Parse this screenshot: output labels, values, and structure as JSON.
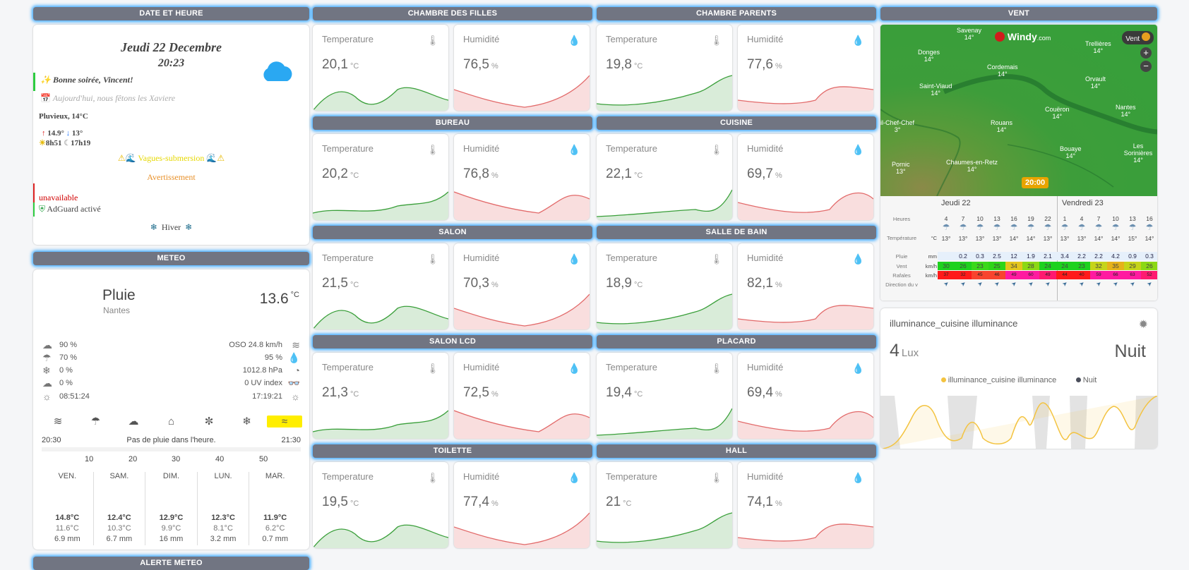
{
  "date": {
    "header": "DATE ET HEURE",
    "day": "Jeudi 22 Decembre",
    "time": "20:23",
    "greeting": "Bonne soirée, Vincent!",
    "saint": "Aujourd'hui, nous fêtons les Xaviere",
    "weather": "Pluvieux, 14°C",
    "tmax": "14.9°",
    "tmin": "13°",
    "sunrise": "8h51",
    "sunset": "17h19",
    "alert_text": "Vagues-submersion",
    "alert_level": "Avertissement",
    "unavailable": "unavailable",
    "adguard": "AdGuard activé",
    "season": "Hiver"
  },
  "meteo": {
    "header": "METEO",
    "condition": "Pluie",
    "city": "Nantes",
    "temp": "13.6",
    "temp_unit": "°C",
    "left": [
      "90 %",
      "70 %",
      "0 %",
      "0 %",
      "08:51:24"
    ],
    "right": [
      "OSO 24.8 km/h",
      "95 %",
      "1012.8 hPa",
      "0 UV index",
      "17:19:21"
    ],
    "rain_start": "20:30",
    "rain_text": "Pas de pluie dans l'heure.",
    "rain_end": "21:30",
    "rain_ticks": [
      "10",
      "20",
      "30",
      "40",
      "50"
    ],
    "forecast": [
      {
        "day": "VEN.",
        "hi": "14.8°C",
        "lo": "11.6°C",
        "rain": "6.9 mm"
      },
      {
        "day": "SAM.",
        "hi": "12.4°C",
        "lo": "10.3°C",
        "rain": "6.7 mm"
      },
      {
        "day": "DIM.",
        "hi": "12.9°C",
        "lo": "9.9°C",
        "rain": "16 mm"
      },
      {
        "day": "LUN.",
        "hi": "12.3°C",
        "lo": "8.1°C",
        "rain": "3.2 mm"
      },
      {
        "day": "MAR.",
        "hi": "11.9°C",
        "lo": "6.2°C",
        "rain": "0.7 mm"
      }
    ]
  },
  "alert_header": "ALERTE METEO",
  "rooms": [
    {
      "name": "CHAMBRE DES FILLES",
      "t": "20,1",
      "h": "76,5"
    },
    {
      "name": "CHAMBRE PARENTS",
      "t": "19,8",
      "h": "77,6"
    },
    {
      "name": "BUREAU",
      "t": "20,2",
      "h": "76,8"
    },
    {
      "name": "CUISINE",
      "t": "22,1",
      "h": "69,7"
    },
    {
      "name": "SALON",
      "t": "21,5",
      "h": "70,3"
    },
    {
      "name": "SALLE DE BAIN",
      "t": "18,9",
      "h": "82,1"
    },
    {
      "name": "SALON LCD",
      "t": "21,3",
      "h": "72,5"
    },
    {
      "name": "PLACARD",
      "t": "19,4",
      "h": "69,4"
    },
    {
      "name": "TOILETTE",
      "t": "19,5",
      "h": "77,4"
    },
    {
      "name": "HALL",
      "t": "21",
      "h": "74,1"
    }
  ],
  "labels": {
    "temp": "Temperature",
    "hum": "Humidité",
    "tu": "°C",
    "hu": "%"
  },
  "vent": {
    "header": "VENT",
    "brand": "Windy",
    "brand_suffix": ".com",
    "toggle": "Vent",
    "cities": [
      {
        "n": "Savenay",
        "v": "14°"
      },
      {
        "n": "Donges",
        "v": "14°"
      },
      {
        "n": "Cordemais",
        "v": "14°"
      },
      {
        "n": "Trellières",
        "v": "14°"
      },
      {
        "n": "Saint-Viaud",
        "v": "14°"
      },
      {
        "n": "Orvault",
        "v": "14°"
      },
      {
        "n": "Couëron",
        "v": "14°"
      },
      {
        "n": "Nantes",
        "v": "14°"
      },
      {
        "n": "Rouans",
        "v": "14°"
      },
      {
        "n": "il-Chef-Chef",
        "v": "3°"
      },
      {
        "n": "Bouaye",
        "v": "14°"
      },
      {
        "n": "Les Sorinières",
        "v": "14°"
      },
      {
        "n": "Pornic",
        "v": "13°"
      },
      {
        "n": "Chaumes-en-Retz",
        "v": "14°"
      }
    ],
    "time_marker": "20:00",
    "day1": "Jeudi 22",
    "day2": "Vendredi 23",
    "rows": [
      "Heures",
      "Température",
      "Pluie",
      "Vent",
      "Rafales",
      "Direction du v"
    ],
    "units": [
      "°C",
      "mm",
      "km/h",
      "km/h"
    ],
    "hours": [
      "4",
      "7",
      "10",
      "13",
      "16",
      "19",
      "22",
      "1",
      "4",
      "7",
      "10",
      "13",
      "16"
    ],
    "temps": [
      "13°",
      "13°",
      "13°",
      "13°",
      "14°",
      "14°",
      "13°",
      "13°",
      "13°",
      "14°",
      "14°",
      "15°",
      "14°"
    ],
    "rain": [
      "",
      "0.2",
      "0.3",
      "2.5",
      "12",
      "1.9",
      "2.1",
      "3.4",
      "2.2",
      "2.2",
      "4.2",
      "0.9",
      "0.3"
    ],
    "wind": [
      "30",
      "26",
      "23",
      "25",
      "34",
      "28",
      "24",
      "24",
      "23",
      "32",
      "35",
      "29",
      "26"
    ],
    "gust": [
      "37",
      "32",
      "45",
      "46",
      "49",
      "60",
      "49",
      "44",
      "40",
      "59",
      "66",
      "63",
      "52"
    ]
  },
  "illum": {
    "title": "illuminance_cuisine illuminance",
    "value": "4",
    "unit": "Lux",
    "state": "Nuit",
    "legend1": "illuminance_cuisine illuminance",
    "legend2": "Nuit"
  }
}
